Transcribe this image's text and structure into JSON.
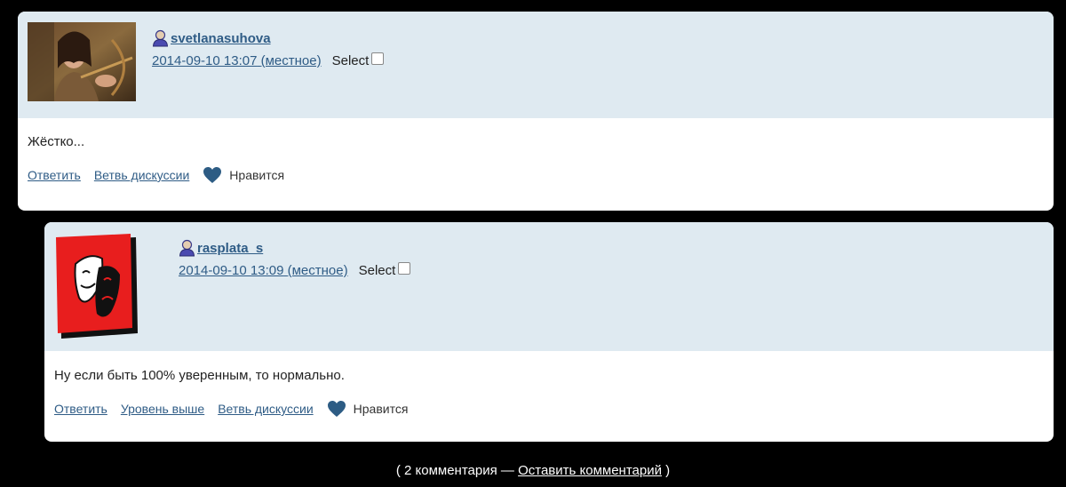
{
  "comments": [
    {
      "username": "svetlanasuhova",
      "date": "2014-09-10 13:07",
      "date_zone": "(местное)",
      "select_label": "Select",
      "select_checked": false,
      "text": "Жёстко...",
      "actions": [
        "Ответить",
        "Ветвь дискуссии"
      ],
      "like_label": "Нравится",
      "avatar_icon": "portrait-photo-icon"
    },
    {
      "username": "rasplata_s",
      "date": "2014-09-10 13:09",
      "date_zone": "(местное)",
      "select_label": "Select",
      "select_checked": false,
      "text": "Ну если быть 100% уверенным, то нормально.",
      "actions": [
        "Ответить",
        "Уровень выше",
        "Ветвь дискуссии"
      ],
      "like_label": "Нравится",
      "avatar_icon": "theater-masks-icon"
    }
  ],
  "footer": {
    "open": "( 2 комментария — ",
    "link": "Оставить комментарий",
    "close": " )"
  },
  "colors": {
    "link": "#2f5c86",
    "header_bg": "#dfeaf1",
    "heart": "#2d5c84",
    "page_bg": "#000000",
    "avatar_red": "#e81e1e"
  }
}
